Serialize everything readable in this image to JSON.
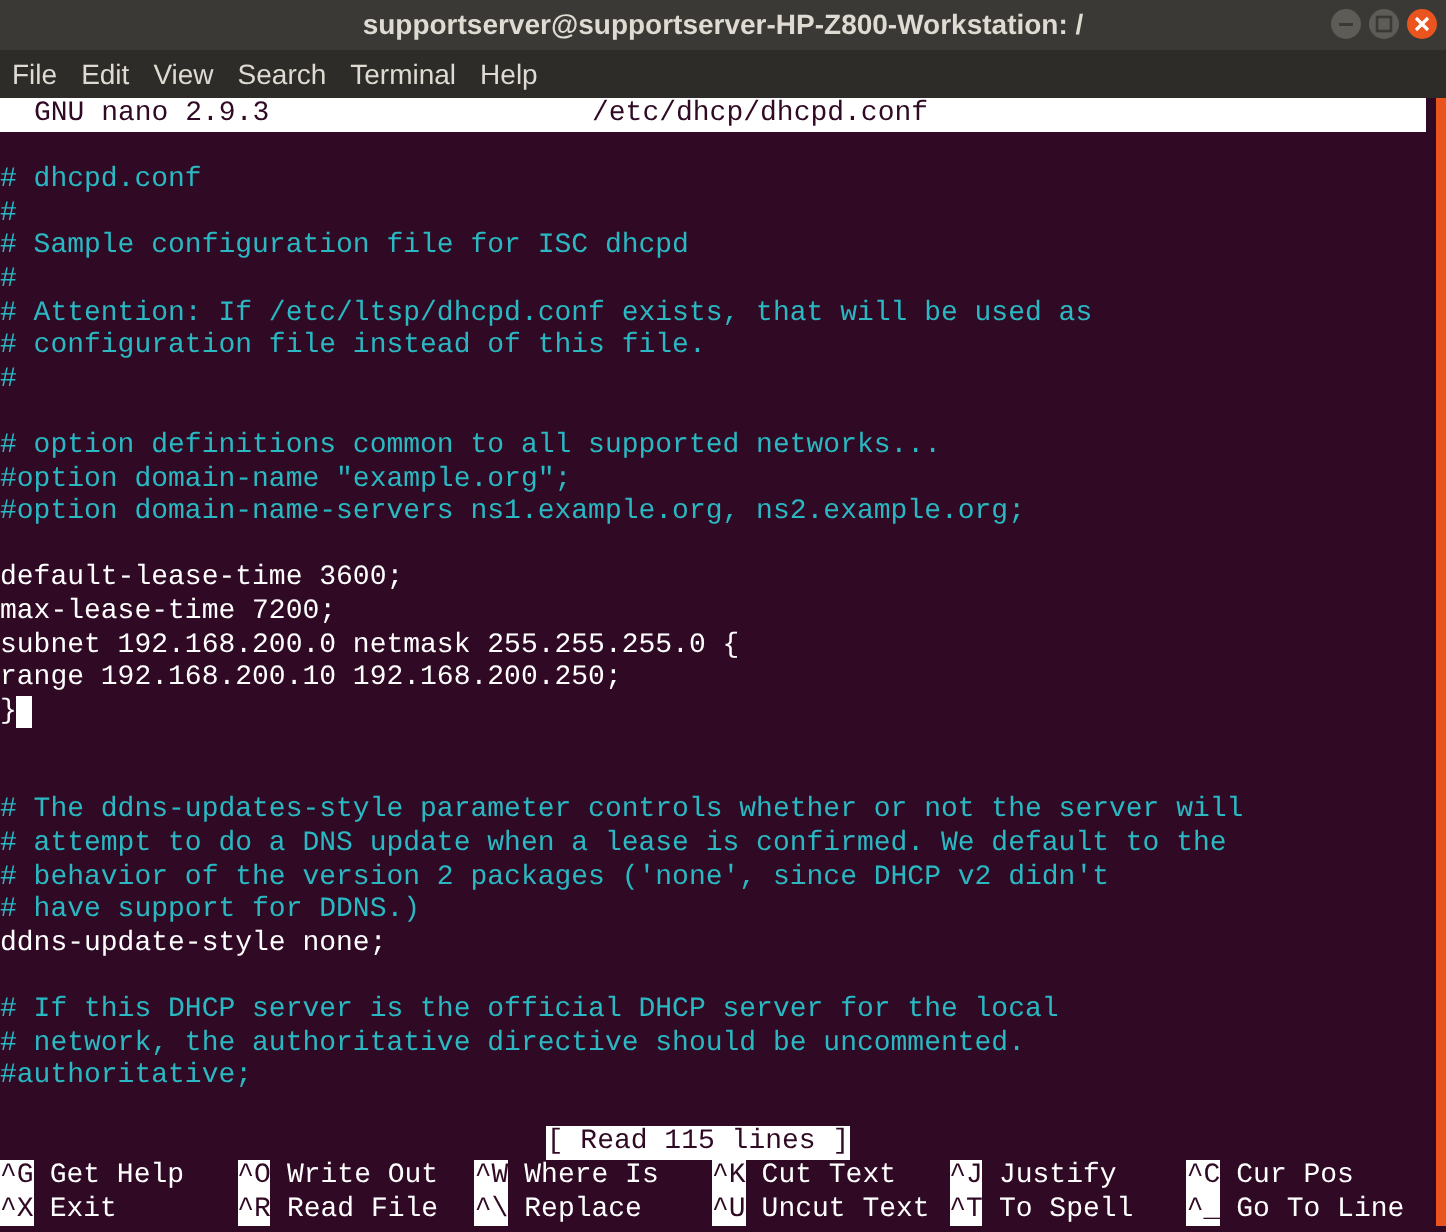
{
  "window": {
    "title": "supportserver@supportserver-HP-Z800-Workstation: /"
  },
  "menu": [
    "File",
    "Edit",
    "View",
    "Search",
    "Terminal",
    "Help"
  ],
  "nano_header": {
    "version": "GNU nano 2.9.3",
    "filename": "/etc/dhcp/dhcpd.conf"
  },
  "lines": [
    {
      "kind": "blank"
    },
    {
      "kind": "comment",
      "text": "# dhcpd.conf",
      "cursor": false
    },
    {
      "kind": "comment",
      "text": "#",
      "cursor": false
    },
    {
      "kind": "comment",
      "text": "# Sample configuration file for ISC dhcpd",
      "cursor": false
    },
    {
      "kind": "comment",
      "text": "#",
      "cursor": false
    },
    {
      "kind": "comment",
      "text": "# Attention: If /etc/ltsp/dhcpd.conf exists, that will be used as",
      "cursor": false
    },
    {
      "kind": "comment",
      "text": "# configuration file instead of this file.",
      "cursor": false
    },
    {
      "kind": "comment",
      "text": "#",
      "cursor": false
    },
    {
      "kind": "blank"
    },
    {
      "kind": "comment",
      "text": "# option definitions common to all supported networks...",
      "cursor": false
    },
    {
      "kind": "comment",
      "text": "#option domain-name \"example.org\";",
      "cursor": false
    },
    {
      "kind": "comment",
      "text": "#option domain-name-servers ns1.example.org, ns2.example.org;",
      "cursor": false
    },
    {
      "kind": "blank"
    },
    {
      "kind": "code",
      "text": "default-lease-time 3600;",
      "cursor": false
    },
    {
      "kind": "code",
      "text": "max-lease-time 7200;",
      "cursor": false
    },
    {
      "kind": "code",
      "text": "subnet 192.168.200.0 netmask 255.255.255.0 {",
      "cursor": false
    },
    {
      "kind": "code",
      "text": "range 192.168.200.10 192.168.200.250;",
      "cursor": false
    },
    {
      "kind": "code",
      "text": "}",
      "cursor": true
    },
    {
      "kind": "blank"
    },
    {
      "kind": "blank"
    },
    {
      "kind": "comment",
      "text": "# The ddns-updates-style parameter controls whether or not the server will",
      "cursor": false
    },
    {
      "kind": "comment",
      "text": "# attempt to do a DNS update when a lease is confirmed. We default to the",
      "cursor": false
    },
    {
      "kind": "comment",
      "text": "# behavior of the version 2 packages ('none', since DHCP v2 didn't",
      "cursor": false
    },
    {
      "kind": "comment",
      "text": "# have support for DDNS.)",
      "cursor": false
    },
    {
      "kind": "code",
      "text": "ddns-update-style none;",
      "cursor": false
    },
    {
      "kind": "blank"
    },
    {
      "kind": "comment",
      "text": "# If this DHCP server is the official DHCP server for the local",
      "cursor": false
    },
    {
      "kind": "comment",
      "text": "# network, the authoritative directive should be uncommented.",
      "cursor": false
    },
    {
      "kind": "comment",
      "text": "#authoritative;",
      "cursor": false
    },
    {
      "kind": "blank"
    }
  ],
  "status": "[ Read 115 lines ]",
  "shortcuts": [
    {
      "key": "^G",
      "label": "Get Help"
    },
    {
      "key": "^O",
      "label": "Write Out"
    },
    {
      "key": "^W",
      "label": "Where Is"
    },
    {
      "key": "^K",
      "label": "Cut Text"
    },
    {
      "key": "^J",
      "label": "Justify"
    },
    {
      "key": "^C",
      "label": "Cur Pos"
    },
    {
      "key": "^X",
      "label": "Exit"
    },
    {
      "key": "^R",
      "label": "Read File"
    },
    {
      "key": "^\\",
      "label": "Replace"
    },
    {
      "key": "^U",
      "label": "Uncut Text"
    },
    {
      "key": "^T",
      "label": "To Spell"
    },
    {
      "key": "^_",
      "label": "Go To Line"
    }
  ]
}
